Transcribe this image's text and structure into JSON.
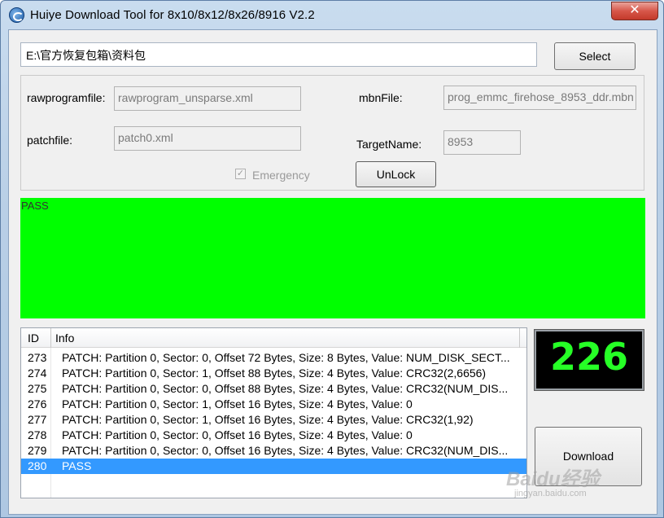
{
  "window": {
    "title": "Huiye Download Tool for 8x10/8x12/8x26/8916 V2.2",
    "close_glyph": "✕"
  },
  "path": {
    "value": "E:\\官方恢复包箱\\资料包"
  },
  "buttons": {
    "select": "Select",
    "unlock": "UnLock",
    "download": "Download"
  },
  "config": {
    "rawprogram_label": "rawprogramfile:",
    "rawprogram_value": "rawprogram_unsparse.xml",
    "patch_label": "patchfile:",
    "patch_value": "patch0.xml",
    "mbn_label": "mbnFile:",
    "mbn_value": "prog_emmc_firehose_8953_ddr.mbn",
    "target_label": "TargetName:",
    "target_value": "8953",
    "emergency_label": "Emergency",
    "emergency_checked": true
  },
  "status": {
    "text": "PASS",
    "color": "#00ff00"
  },
  "log": {
    "columns": [
      "ID",
      "Info"
    ],
    "rows": [
      {
        "id": "273",
        "info": "PATCH: Partition 0, Sector: 0, Offset 72 Bytes, Size: 8 Bytes, Value: NUM_DISK_SECT..."
      },
      {
        "id": "274",
        "info": "PATCH: Partition 0, Sector: 1, Offset 88 Bytes, Size: 4 Bytes, Value: CRC32(2,6656)"
      },
      {
        "id": "275",
        "info": "PATCH: Partition 0, Sector: 0, Offset 88 Bytes, Size: 4 Bytes, Value: CRC32(NUM_DIS..."
      },
      {
        "id": "276",
        "info": "PATCH: Partition 0, Sector: 1, Offset 16 Bytes, Size: 4 Bytes, Value: 0"
      },
      {
        "id": "277",
        "info": "PATCH: Partition 0, Sector: 1, Offset 16 Bytes, Size: 4 Bytes, Value: CRC32(1,92)"
      },
      {
        "id": "278",
        "info": "PATCH: Partition 0, Sector: 0, Offset 16 Bytes, Size: 4 Bytes, Value: 0"
      },
      {
        "id": "279",
        "info": "PATCH: Partition 0, Sector: 0, Offset 16 Bytes, Size: 4 Bytes, Value: CRC32(NUM_DIS..."
      },
      {
        "id": "280",
        "info": "PASS",
        "selected": true
      }
    ]
  },
  "counter": {
    "value": "226",
    "color": "#26ff26"
  },
  "watermark": {
    "text": "Baidu经验",
    "sub": "jingyan.baidu.com"
  }
}
